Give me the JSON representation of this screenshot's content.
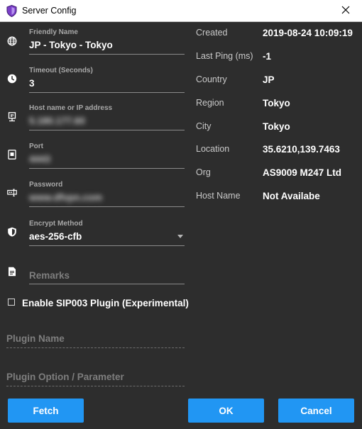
{
  "window": {
    "title": "Server Config"
  },
  "fields": {
    "friendly_name": {
      "label": "Friendly Name",
      "value": "JP - Tokyo - Tokyo"
    },
    "timeout": {
      "label": "Timeout (Seconds)",
      "value": "3"
    },
    "host": {
      "label": "Host name or IP address",
      "value": "5.180.177.60"
    },
    "port": {
      "label": "Port",
      "value": "4443"
    },
    "password": {
      "label": "Password",
      "value": "www.dfvpn.com"
    },
    "encrypt": {
      "label": "Encrypt Method",
      "value": "aes-256-cfb"
    },
    "remarks": {
      "placeholder": "Remarks"
    }
  },
  "plugin": {
    "enable_label": "Enable SIP003 Plugin (Experimental)",
    "enabled": false,
    "name_placeholder": "Plugin Name",
    "option_placeholder": "Plugin Option / Parameter"
  },
  "info": [
    {
      "label": "Created",
      "value": "2019-08-24 10:09:19"
    },
    {
      "label": "Last Ping (ms)",
      "value": "-1"
    },
    {
      "label": "Country",
      "value": "JP"
    },
    {
      "label": "Region",
      "value": "Tokyo"
    },
    {
      "label": "City",
      "value": "Tokyo"
    },
    {
      "label": "Location",
      "value": "35.6210,139.7463"
    },
    {
      "label": "Org",
      "value": "AS9009 M247 Ltd"
    },
    {
      "label": "Host Name",
      "value": "Not Availabe"
    }
  ],
  "buttons": {
    "fetch": "Fetch",
    "ok": "OK",
    "cancel": "Cancel"
  },
  "colors": {
    "background": "#2d2d2d",
    "accent": "#2196f3",
    "titlebar": "#ffffff",
    "text": "#ffffff",
    "label": "#a8a8a8"
  },
  "icons": {
    "friendly_name": "globe-icon",
    "timeout": "clock-icon",
    "host": "ip-address-icon",
    "port": "port-icon",
    "password": "password-key-icon",
    "encrypt": "shield-icon",
    "remarks": "document-icon"
  }
}
